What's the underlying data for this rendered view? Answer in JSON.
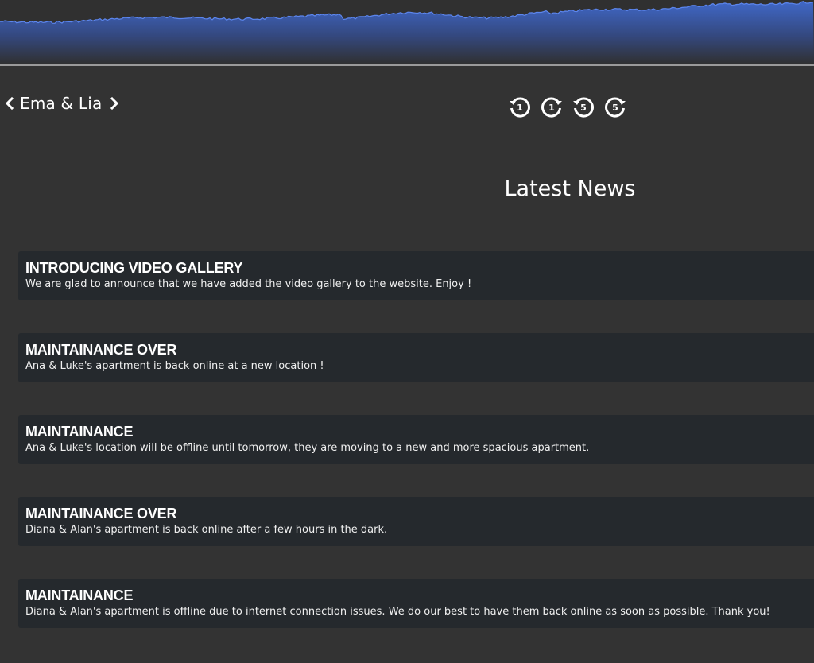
{
  "room_nav": {
    "current_room": "Ema & Lia",
    "prev_icon": "chevron-left-icon",
    "next_icon": "chevron-right-icon"
  },
  "seek_controls": [
    {
      "icon": "rewind-1-icon",
      "label": "1"
    },
    {
      "icon": "forward-1-icon",
      "label": "1"
    },
    {
      "icon": "rewind-5-icon",
      "label": "5"
    },
    {
      "icon": "forward-5-icon",
      "label": "5"
    }
  ],
  "news": {
    "title": "Latest News",
    "items": [
      {
        "headline": "INTRODUCING VIDEO GALLERY",
        "body": "We are glad to announce that we have added the video gallery to the website. Enjoy !"
      },
      {
        "headline": "MAINTAINANCE OVER",
        "body": "Ana & Luke's apartment is back online at a new location !"
      },
      {
        "headline": "MAINTAINANCE",
        "body": "Ana & Luke's location will be offline until tomorrow, they are moving to a new and more spacious apartment."
      },
      {
        "headline": "MAINTAINANCE OVER",
        "body": "Diana & Alan's apartment is back online after a few hours in the dark."
      },
      {
        "headline": "MAINTAINANCE",
        "body": "Diana & Alan's apartment is offline due to internet connection issues. We do our best to have them back online as soon as possible. Thank you!"
      }
    ]
  },
  "colors": {
    "background": "#333333",
    "card": "#25292d",
    "activity_fill": "#3d63c2",
    "activity_line": "#5c86ee",
    "divider": "#9a9a9a"
  }
}
